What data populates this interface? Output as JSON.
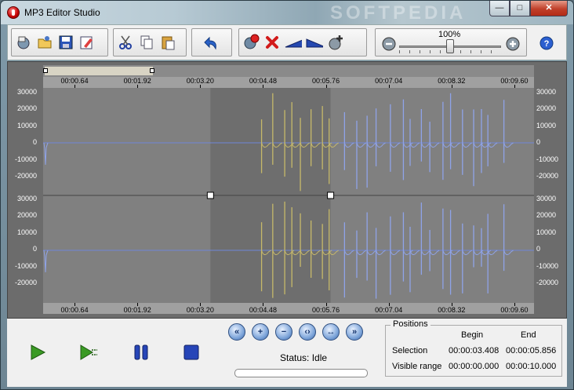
{
  "window": {
    "title": "MP3 Editor Studio",
    "watermark": "SOFTPEDIA",
    "controls": {
      "minimize": "—",
      "maximize": "□",
      "close": "✕"
    }
  },
  "toolbar": {
    "file_group": [
      "open-recent-icon",
      "open-folder-icon",
      "save-icon",
      "edit-tags-icon"
    ],
    "clipboard_group": [
      "cut-icon",
      "copy-icon",
      "paste-icon"
    ],
    "undo_group": [
      "undo-icon"
    ],
    "effects_group": [
      "remove-effect-icon",
      "delete-icon",
      "fade-in-icon",
      "fade-out-icon",
      "add-effect-icon"
    ],
    "volume": {
      "label": "100%",
      "value_percent": 100,
      "slider_fraction": 0.5
    },
    "help_icon": "help-icon"
  },
  "waveform": {
    "top_ruler": [
      "00:00.64",
      "00:01.92",
      "00:03.20",
      "00:04.48",
      "00:05.76",
      "00:07.04",
      "00:08.32",
      "00:09.60"
    ],
    "bottom_ruler": [
      "00:00.64",
      "00:01.92",
      "00:03.20",
      "00:04.48",
      "00:05.76",
      "00:07.04",
      "00:08.32",
      "00:09.60"
    ],
    "amplitude_labels": [
      "30000",
      "20000",
      "10000",
      "0",
      "-10000",
      "-20000"
    ],
    "duration_seconds": 10.0,
    "selection_seconds": [
      3.408,
      5.856
    ],
    "colors": {
      "background": "#808080",
      "selected": "#6e6e6e",
      "wave": "#8fa3e8",
      "wave_selected": "#c7b96a",
      "centerline": "#6f86d8"
    }
  },
  "transport": {
    "buttons": [
      "play-icon",
      "play-selection-icon",
      "pause-icon",
      "stop-icon"
    ]
  },
  "zoom_controls": [
    "scroll-left-icon",
    "zoom-in-icon",
    "zoom-out-icon",
    "zoom-selection-icon",
    "zoom-full-icon",
    "scroll-right-icon"
  ],
  "status": {
    "text": "Status: Idle"
  },
  "positions": {
    "title": "Positions",
    "col_begin": "Begin",
    "col_end": "End",
    "rows": [
      {
        "label": "Selection",
        "begin": "00:00:03.408",
        "end": "00:00:05.856"
      },
      {
        "label": "Visible range",
        "begin": "00:00:00.000",
        "end": "00:00:10.000"
      }
    ]
  }
}
